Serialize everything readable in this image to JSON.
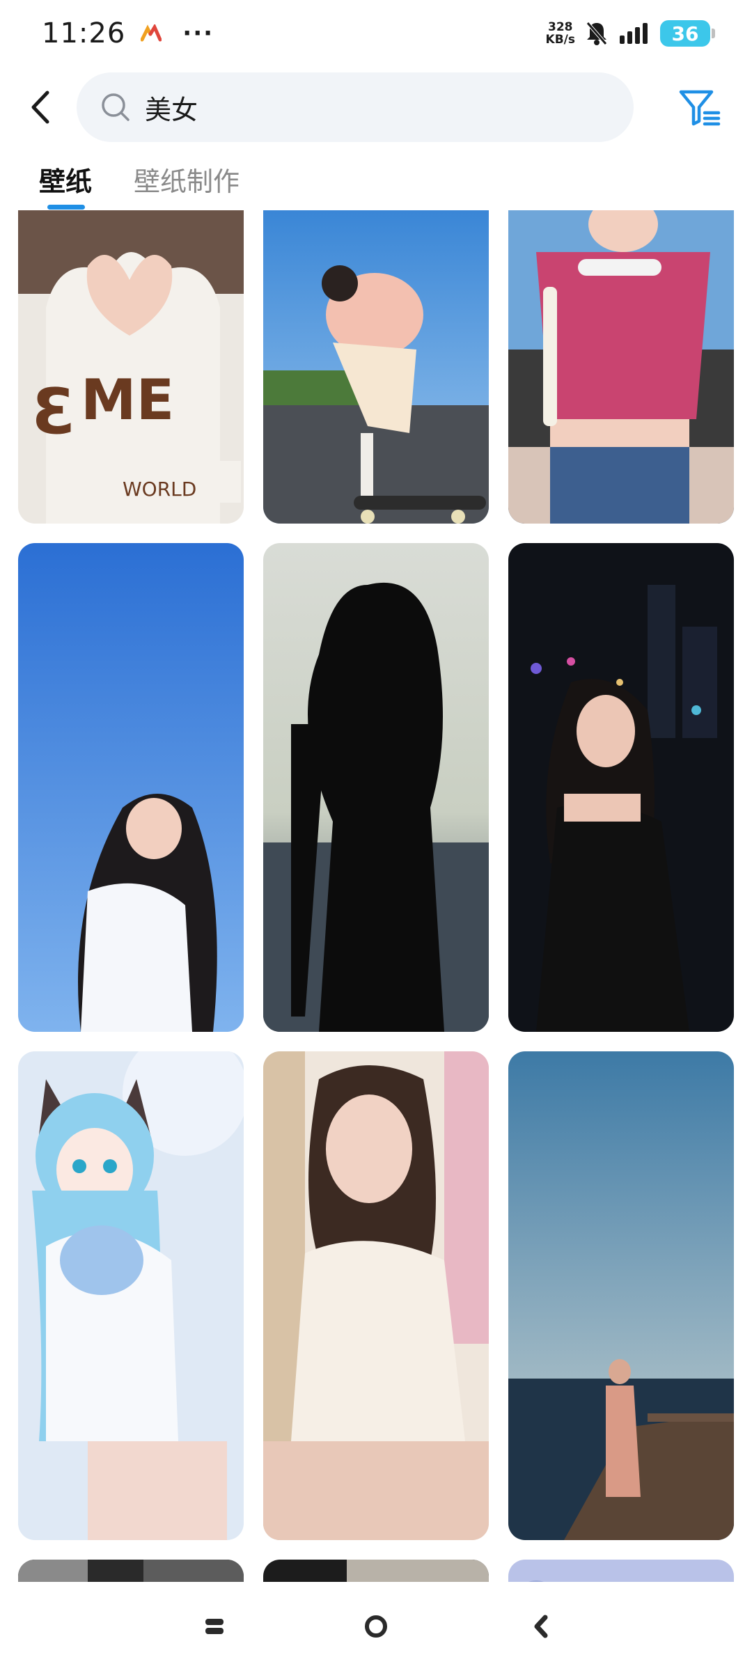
{
  "status_bar": {
    "time": "11:26",
    "dots": "···",
    "net_speed_value": "328",
    "net_speed_unit": "KB/s",
    "battery": "36"
  },
  "search": {
    "query": "美女"
  },
  "tabs": [
    {
      "label": "壁纸",
      "active": true
    },
    {
      "label": "壁纸制作",
      "active": false
    }
  ],
  "colors": {
    "accent": "#1f8fe5",
    "search_bg": "#f1f4f8",
    "battery": "#3cc7ea"
  },
  "wallpapers": [
    {
      "name": "wallpaper-heart-hands"
    },
    {
      "name": "wallpaper-skateboard-girl"
    },
    {
      "name": "wallpaper-pink-top-girl"
    },
    {
      "name": "wallpaper-blue-sky-girl"
    },
    {
      "name": "wallpaper-silhouette-girl"
    },
    {
      "name": "wallpaper-night-city-girl"
    },
    {
      "name": "wallpaper-anime-cat-girl"
    },
    {
      "name": "wallpaper-white-dress-girl"
    },
    {
      "name": "wallpaper-sea-pier-girl"
    },
    {
      "name": "wallpaper-partial-1"
    },
    {
      "name": "wallpaper-partial-2"
    },
    {
      "name": "wallpaper-partial-3"
    }
  ],
  "icons": [
    "back-arrow-icon",
    "search-icon",
    "filter-icon",
    "recents-icon",
    "home-icon",
    "nav-back-icon"
  ]
}
